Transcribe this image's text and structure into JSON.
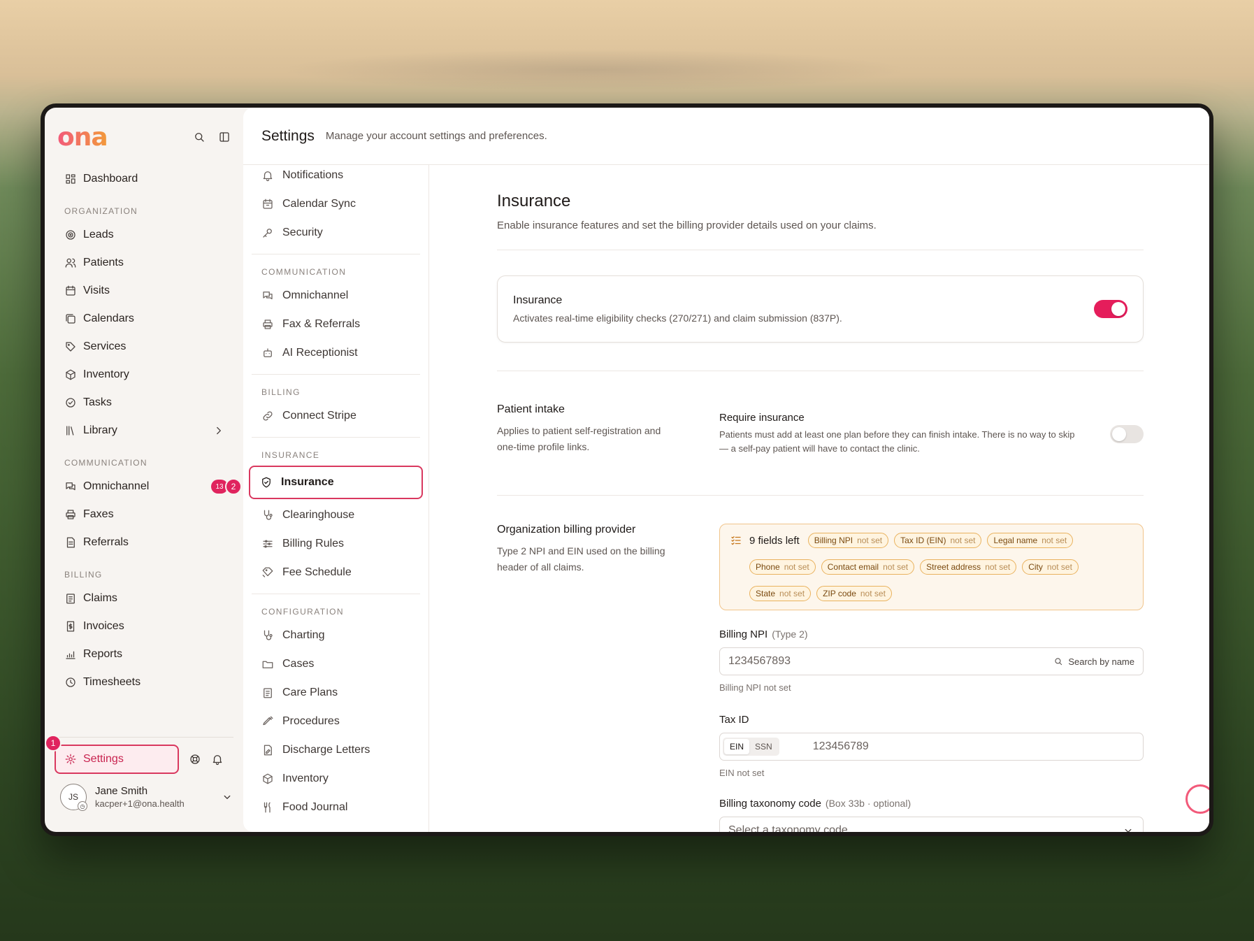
{
  "brand": {
    "logo": "ona",
    "accent": "#e51d5b"
  },
  "sidebar": {
    "top_items": [
      {
        "label": "Dashboard",
        "icon": "dashboard-icon"
      }
    ],
    "sections": [
      {
        "title": "ORGANIZATION",
        "items": [
          {
            "label": "Leads",
            "icon": "target-icon"
          },
          {
            "label": "Patients",
            "icon": "users-icon"
          },
          {
            "label": "Visits",
            "icon": "calendar-icon"
          },
          {
            "label": "Calendars",
            "icon": "calendars-icon"
          },
          {
            "label": "Services",
            "icon": "tag-icon"
          },
          {
            "label": "Inventory",
            "icon": "box-icon"
          },
          {
            "label": "Tasks",
            "icon": "check-circle-icon"
          },
          {
            "label": "Library",
            "icon": "library-icon"
          }
        ]
      },
      {
        "title": "COMMUNICATION",
        "items": [
          {
            "label": "Omnichannel",
            "icon": "chat-icon",
            "badge": "13"
          },
          {
            "label": "Faxes",
            "icon": "printer-icon"
          },
          {
            "label": "Referrals",
            "icon": "document-icon"
          }
        ]
      },
      {
        "title": "BILLING",
        "items": [
          {
            "label": "Claims",
            "icon": "clipboard-icon"
          },
          {
            "label": "Invoices",
            "icon": "invoice-icon"
          },
          {
            "label": "Reports",
            "icon": "chart-icon"
          },
          {
            "label": "Timesheets",
            "icon": "clock-icon"
          }
        ]
      }
    ],
    "settings_label": "Settings",
    "user": {
      "initials": "JS",
      "name": "Jane Smith",
      "email": "kacper+1@ona.health"
    },
    "step_badges": [
      "1",
      "2"
    ]
  },
  "header": {
    "title": "Settings",
    "subtitle": "Manage your account settings and preferences."
  },
  "subnav": {
    "top_items": [
      "Notifications",
      "Calendar Sync",
      "Security"
    ],
    "sections": [
      {
        "title": "COMMUNICATION",
        "items": [
          "Omnichannel",
          "Fax & Referrals",
          "AI Receptionist"
        ]
      },
      {
        "title": "BILLING",
        "items": [
          "Connect Stripe"
        ]
      },
      {
        "title": "INSURANCE",
        "items": [
          "Insurance",
          "Clearinghouse",
          "Billing Rules",
          "Fee Schedule"
        ]
      },
      {
        "title": "CONFIGURATION",
        "items": [
          "Charting",
          "Cases",
          "Care Plans",
          "Procedures",
          "Discharge Letters",
          "Inventory",
          "Food Journal"
        ]
      }
    ],
    "active": "Insurance"
  },
  "insurance": {
    "title": "Insurance",
    "subtitle": "Enable insurance features and set the billing provider details used on your claims.",
    "toggle_card": {
      "title": "Insurance",
      "subtitle": "Activates real-time eligibility checks (270/271) and claim submission (837P).",
      "enabled": true
    },
    "intake": {
      "title": "Patient intake",
      "subtitle": "Applies to patient self-registration and one-time profile links.",
      "require_title": "Require insurance",
      "require_sub": "Patients must add at least one plan before they can finish intake. There is no way to skip — a self-pay patient will have to contact the clinic.",
      "require_enabled": false
    },
    "billing_provider": {
      "title": "Organization billing provider",
      "subtitle": "Type 2 NPI and EIN used on the billing header of all claims.",
      "fields_left": "9 fields left",
      "not_set": "not set",
      "missing": [
        "Billing NPI",
        "Tax ID (EIN)",
        "Legal name",
        "Phone",
        "Contact email",
        "Street address",
        "City",
        "State",
        "ZIP code"
      ]
    },
    "billing_npi": {
      "label": "Billing NPI",
      "qualifier": "(Type 2)",
      "placeholder": "1234567893",
      "search_label": "Search by name",
      "hint": "Billing NPI not set"
    },
    "tax_id": {
      "label": "Tax ID",
      "options": [
        "EIN",
        "SSN"
      ],
      "selected": "EIN",
      "placeholder": "123456789",
      "hint": "EIN not set"
    },
    "taxonomy": {
      "label": "Billing taxonomy code",
      "qualifier": "(Box 33b · optional)",
      "placeholder": "Select a taxonomy code"
    }
  }
}
